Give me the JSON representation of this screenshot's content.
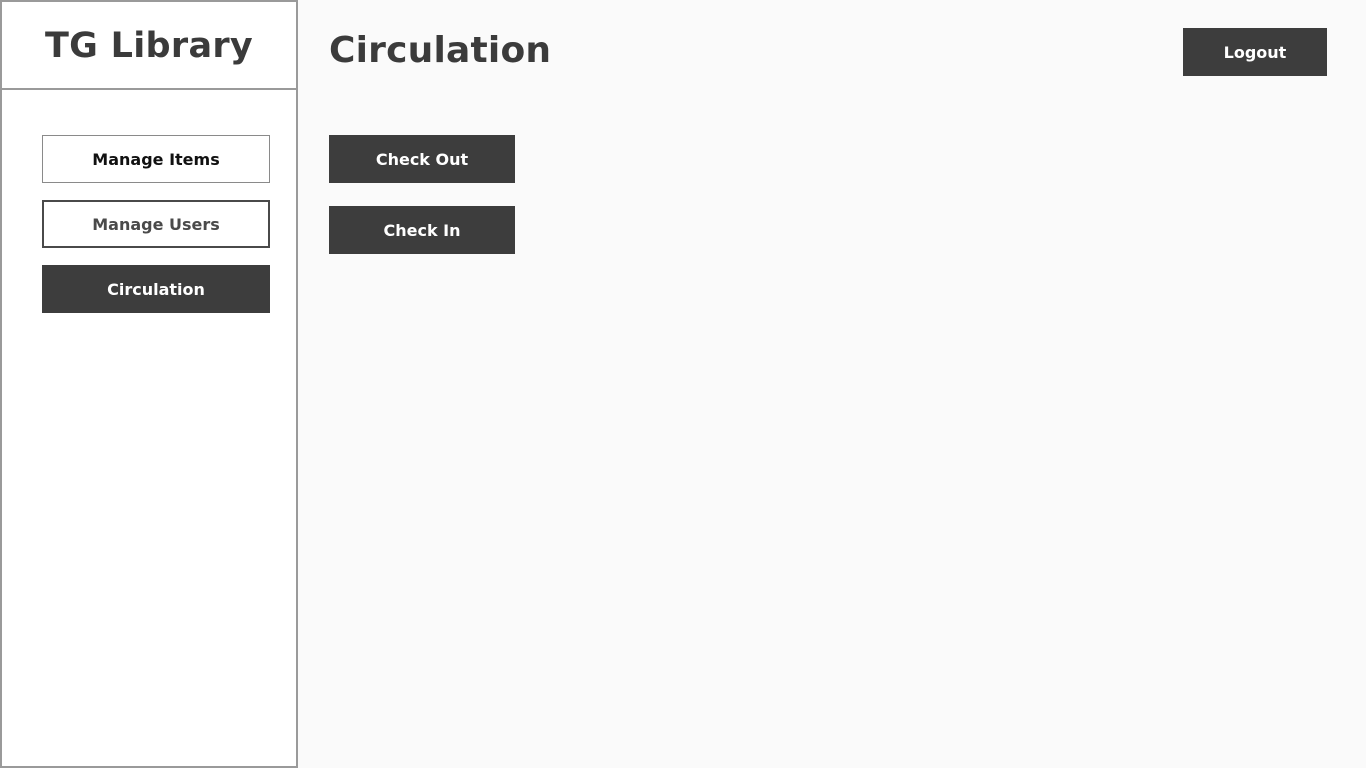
{
  "sidebar": {
    "brand": "TG Library",
    "items": [
      {
        "label": "Manage Items",
        "state": "default"
      },
      {
        "label": "Manage Users",
        "state": "default"
      },
      {
        "label": "Circulation",
        "state": "active"
      }
    ]
  },
  "header": {
    "title": "Circulation",
    "logout_label": "Logout"
  },
  "main": {
    "actions": [
      {
        "label": "Check Out"
      },
      {
        "label": "Check In"
      }
    ]
  },
  "colors": {
    "background": "#fafafa",
    "sidebar_background": "#ffffff",
    "button_dark": "#3d3d3d",
    "button_text": "#ffffff",
    "border": "#9a9a9a",
    "text": "#3b3b3b"
  }
}
